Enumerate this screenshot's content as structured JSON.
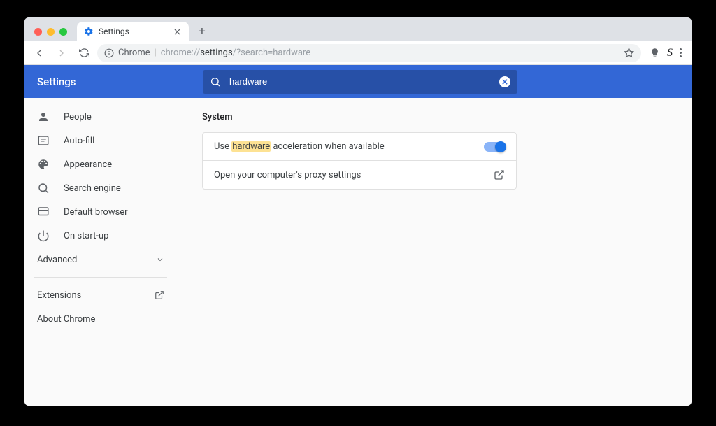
{
  "tab": {
    "title": "Settings"
  },
  "omnibox": {
    "chrome_label": "Chrome",
    "url_prefix": "chrome://",
    "url_bold": "settings",
    "url_suffix": "/?search=hardware"
  },
  "header": {
    "title": "Settings"
  },
  "search": {
    "value": "hardware"
  },
  "sidebar": {
    "items": [
      {
        "label": "People"
      },
      {
        "label": "Auto-fill"
      },
      {
        "label": "Appearance"
      },
      {
        "label": "Search engine"
      },
      {
        "label": "Default browser"
      },
      {
        "label": "On start-up"
      }
    ],
    "advanced": "Advanced",
    "extensions": "Extensions",
    "about": "About Chrome"
  },
  "main": {
    "section_title": "System",
    "row1_prefix": "Use ",
    "row1_highlight": "hardware",
    "row1_suffix": " acceleration when available",
    "row2": "Open your computer's proxy settings"
  }
}
